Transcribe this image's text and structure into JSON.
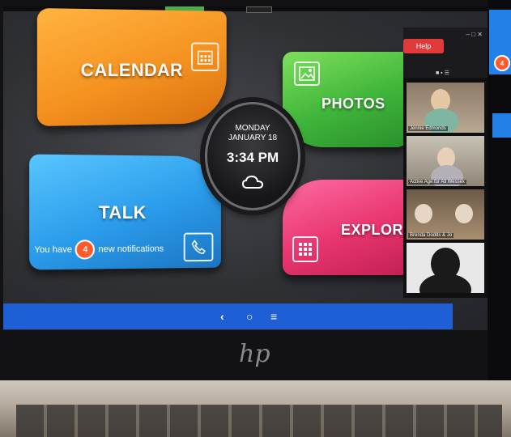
{
  "launcher": {
    "calendar_label": "CALENDAR",
    "photos_label": "PHOTOS",
    "talk_label": "TALK",
    "explore_label": "EXPLORE",
    "notification_prefix": "You have",
    "notification_count": "4",
    "notification_suffix": "new notifications"
  },
  "clock": {
    "day": "MONDAY",
    "date": "JANUARY 18",
    "time": "3:34 PM",
    "weather_icon": "cloud-icon"
  },
  "video_call": {
    "help_label": "Help",
    "participants": [
      {
        "name": "Jennie Edmonds"
      },
      {
        "name": "Active Age for All Wessex"
      },
      {
        "name": "Brenda Dodds & Jo"
      },
      {
        "name": ""
      }
    ]
  },
  "taskbar": {
    "icons": [
      "back-icon",
      "home-icon",
      "menu-icon"
    ]
  },
  "side_badge": "4",
  "colors": {
    "calendar": "#f59220",
    "photos": "#3fb53a",
    "talk": "#2a9bea",
    "explore": "#e8356f",
    "taskbar": "#1f5fd6",
    "badge": "#ff5a2b"
  }
}
